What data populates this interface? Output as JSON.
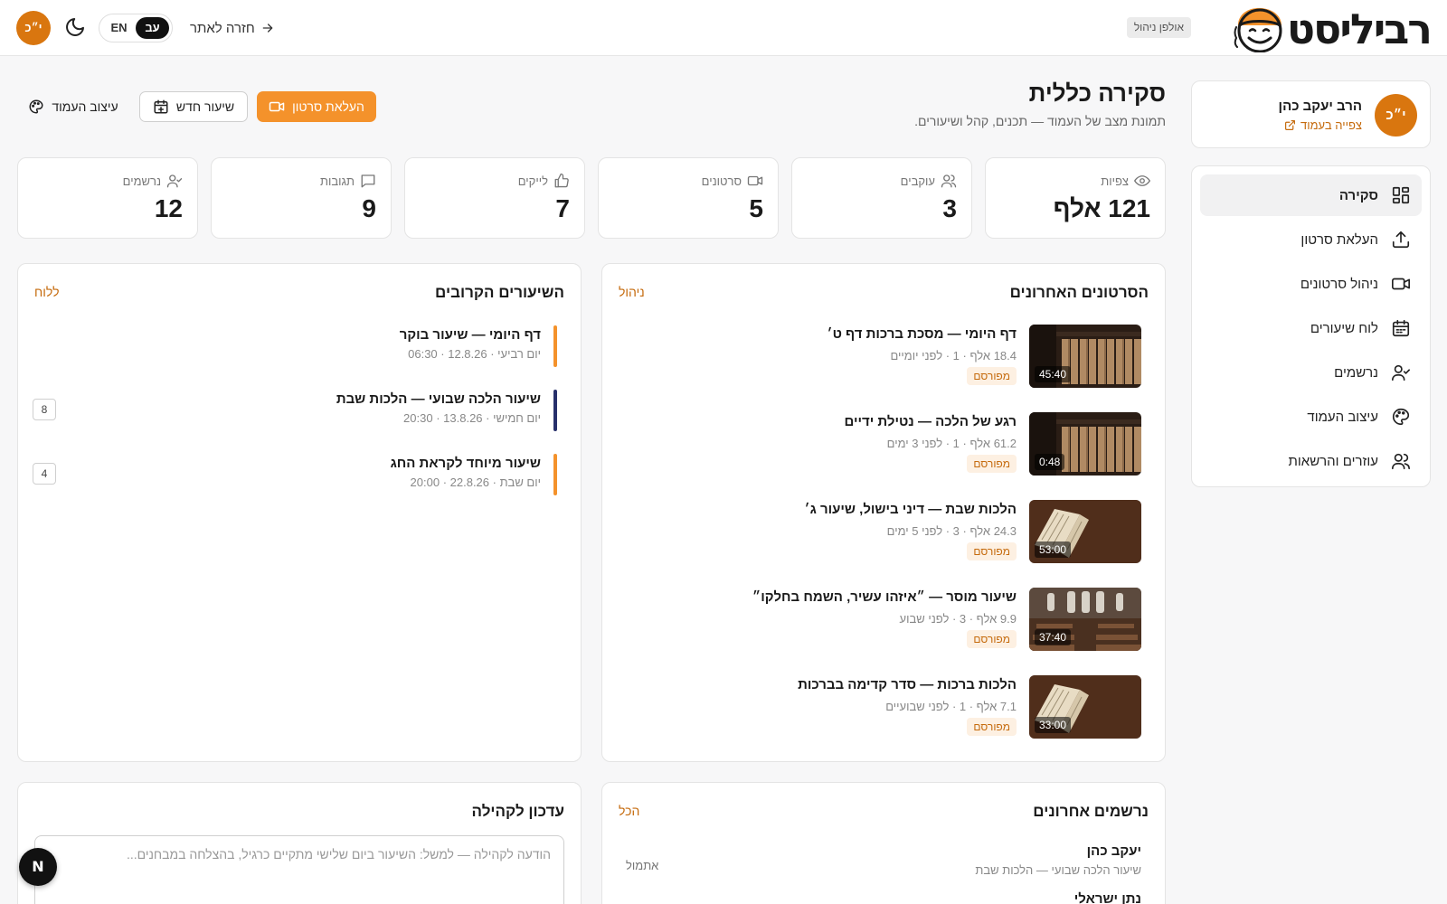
{
  "header": {
    "logo_text": "רביליסט",
    "admin_badge": "אולפן ניהול",
    "back_label": "חזרה לאתר",
    "lang_he": "עב",
    "lang_en": "EN",
    "user_initials": "י״כ"
  },
  "profile": {
    "initials": "י״כ",
    "name": "הרב יעקב כהן",
    "view_page_label": "צפייה בעמוד"
  },
  "sidebar": {
    "items": [
      {
        "label": "סקירה",
        "icon": "grid-icon",
        "active": true
      },
      {
        "label": "העלאת סרטון",
        "icon": "upload-icon"
      },
      {
        "label": "ניהול סרטונים",
        "icon": "video-icon"
      },
      {
        "label": "לוח שיעורים",
        "icon": "calendar-icon"
      },
      {
        "label": "נרשמים",
        "icon": "user-check-icon"
      },
      {
        "label": "עיצוב העמוד",
        "icon": "palette-icon"
      },
      {
        "label": "עוזרים והרשאות",
        "icon": "users-icon"
      }
    ]
  },
  "page": {
    "title": "סקירה כללית",
    "subtitle": "תמונת מצב של העמוד — תכנים, קהל ושיעורים."
  },
  "actions": {
    "upload": "העלאת סרטון",
    "new_lesson": "שיעור חדש",
    "design": "עיצוב העמוד"
  },
  "stats": [
    {
      "label": "צפיות",
      "value": "121 אלף",
      "icon": "eye-icon"
    },
    {
      "label": "עוקבים",
      "value": "3",
      "icon": "users-icon"
    },
    {
      "label": "סרטונים",
      "value": "5",
      "icon": "video-icon"
    },
    {
      "label": "לייקים",
      "value": "7",
      "icon": "thumbs-up-icon"
    },
    {
      "label": "תגובות",
      "value": "9",
      "icon": "comment-icon"
    },
    {
      "label": "נרשמים",
      "value": "12",
      "icon": "user-check-icon"
    }
  ],
  "recent_videos": {
    "title": "הסרטונים האחרונים",
    "link": "ניהול",
    "items": [
      {
        "title": "דף היומי — מסכת ברכות דף ט׳",
        "meta": "18.4 אלף · 1 · לפני יומיים",
        "status": "מפורסם",
        "duration": "45:40",
        "thumb": "library"
      },
      {
        "title": "רגע של הלכה — נטילת ידיים",
        "meta": "61.2 אלף · 1 · לפני 3 ימים",
        "status": "מפורסם",
        "duration": "0:48",
        "thumb": "library"
      },
      {
        "title": "הלכות שבת — דיני בישול, שיעור ג׳",
        "meta": "24.3 אלף · 3 · לפני 5 ימים",
        "status": "מפורסם",
        "duration": "53:00",
        "thumb": "book"
      },
      {
        "title": "שיעור מוסר — ״איזהו עשיר, השמח בחלקו״",
        "meta": "9.9 אלף · 3 · לפני שבוע",
        "status": "מפורסם",
        "duration": "37:40",
        "thumb": "hall"
      },
      {
        "title": "הלכות ברכות — סדר קדימה בברכות",
        "meta": "7.1 אלף · 1 · לפני שבועיים",
        "status": "מפורסם",
        "duration": "33:00",
        "thumb": "book"
      }
    ]
  },
  "upcoming": {
    "title": "השיעורים הקרובים",
    "link": "ללוח",
    "items": [
      {
        "title": "דף היומי — שיעור בוקר",
        "meta": "יום רביעי · 12.8.26 · 06:30",
        "count": "",
        "color": "#f4922b"
      },
      {
        "title": "שיעור הלכה שבועי — הלכות שבת",
        "meta": "יום חמישי · 13.8.26 · 20:30",
        "count": "8",
        "color": "#27306b"
      },
      {
        "title": "שיעור מיוחד לקראת החג",
        "meta": "יום שבת · 22.8.26 · 20:00",
        "count": "4",
        "color": "#f4922b"
      }
    ]
  },
  "subscribers": {
    "title": "נרשמים אחרונים",
    "link": "הכל",
    "items": [
      {
        "name": "יעקב כהן",
        "lesson": "שיעור הלכה שבועי — הלכות שבת",
        "date": "אתמול"
      },
      {
        "name": "נתן ישראלי"
      }
    ]
  },
  "community": {
    "title": "עדכון לקהילה",
    "placeholder": "הודעה לקהילה — למשל: השיעור ביום שלישי מתקיים כרגיל, בהצלחה במבחנים..."
  },
  "fab": {
    "label": "N"
  }
}
